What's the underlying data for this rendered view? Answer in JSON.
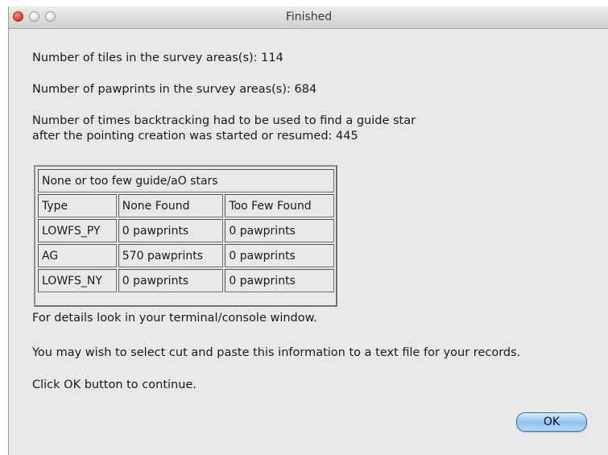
{
  "window": {
    "title": "Finished"
  },
  "messages": {
    "tiles": "Number of tiles in the survey areas(s): 114",
    "pawprints": "Number of pawprints in the survey areas(s): 684",
    "backtracking_line1": "Number of times backtracking had to be used to find a guide star",
    "backtracking_line2": "after the pointing creation was started or resumed: 445",
    "details": "For details look in your terminal/console window.",
    "copy_hint": "You may wish to select cut and paste this information to a text file for your records.",
    "continue_hint": "Click OK button to continue."
  },
  "table": {
    "caption": "None or too few guide/aO stars",
    "headers": [
      "Type",
      "None Found",
      "Too Few Found"
    ],
    "rows": [
      [
        "LOWFS_PY",
        "0 pawprints",
        "0 pawprints"
      ],
      [
        "AG",
        "570 pawprints",
        "0 pawprints"
      ],
      [
        "LOWFS_NY",
        "0 pawprints",
        "0 pawprints"
      ]
    ]
  },
  "buttons": {
    "ok_label": "OK"
  },
  "icons": {
    "close": "close-icon",
    "minimize": "minimize-icon",
    "zoom": "zoom-icon"
  },
  "colors": {
    "close_button": "#e0443a",
    "ok_button": "#8fc2f3",
    "window_background": "#e8e8e8"
  }
}
